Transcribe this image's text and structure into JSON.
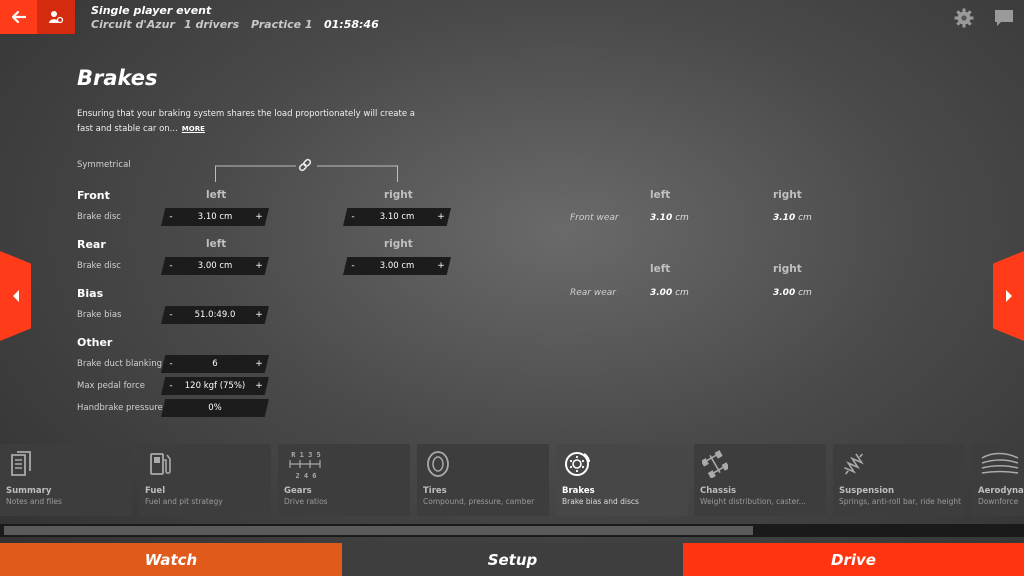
{
  "header": {
    "event_title": "Single player event",
    "track": "Circuit d'Azur",
    "drivers": "1 drivers",
    "session": "Practice 1",
    "time": "01:58:46"
  },
  "page": {
    "title": "Brakes",
    "description": "Ensuring that your braking system shares the load proportionately will create a fast and stable car on...",
    "more": "MORE",
    "symmetrical": "Symmetrical"
  },
  "front": {
    "section": "Front",
    "left_head": "left",
    "right_head": "right",
    "row_label": "Brake disc",
    "left_value": "3.10 cm",
    "right_value": "3.10 cm"
  },
  "rear": {
    "section": "Rear",
    "left_head": "left",
    "right_head": "right",
    "row_label": "Brake disc",
    "left_value": "3.00 cm",
    "right_value": "3.00 cm"
  },
  "bias": {
    "section": "Bias",
    "row_label": "Brake bias",
    "value": "51.0:49.0"
  },
  "other": {
    "section": "Other",
    "duct_label": "Brake duct blanking",
    "duct_value": "6",
    "pedal_label": "Max pedal force",
    "pedal_value": "120 kgf (75%)",
    "handbrake_label": "Handbrake pressure",
    "handbrake_value": "0%"
  },
  "wear": {
    "front_left_head": "left",
    "front_right_head": "right",
    "front_label": "Front wear",
    "front_left": "3.10",
    "front_right": "3.10",
    "rear_left_head": "left",
    "rear_right_head": "right",
    "rear_label": "Rear wear",
    "rear_left": "3.00",
    "rear_right": "3.00",
    "unit": "cm"
  },
  "stepper": {
    "minus": "-",
    "plus": "+"
  },
  "tiles": [
    {
      "name": "Summary",
      "desc": "Notes and files"
    },
    {
      "name": "Fuel",
      "desc": "Fuel and pit strategy"
    },
    {
      "name": "Gears",
      "desc": "Drive ratios",
      "icon_text": "R 1 3 5",
      "icon_text2": "2 4 6"
    },
    {
      "name": "Tires",
      "desc": "Compound, pressure, camber"
    },
    {
      "name": "Brakes",
      "desc": "Brake bias and discs"
    },
    {
      "name": "Chassis",
      "desc": "Weight distribution, caster..."
    },
    {
      "name": "Suspension",
      "desc": "Springs, anti-roll bar, ride height"
    },
    {
      "name": "Aerodynamics",
      "desc": "Downforce"
    }
  ],
  "footer": {
    "watch": "Watch",
    "setup": "Setup",
    "drive": "Drive"
  },
  "colors": {
    "accent": "#ff3b1a",
    "watch": "#e05a1c",
    "drive": "#ff3512"
  }
}
